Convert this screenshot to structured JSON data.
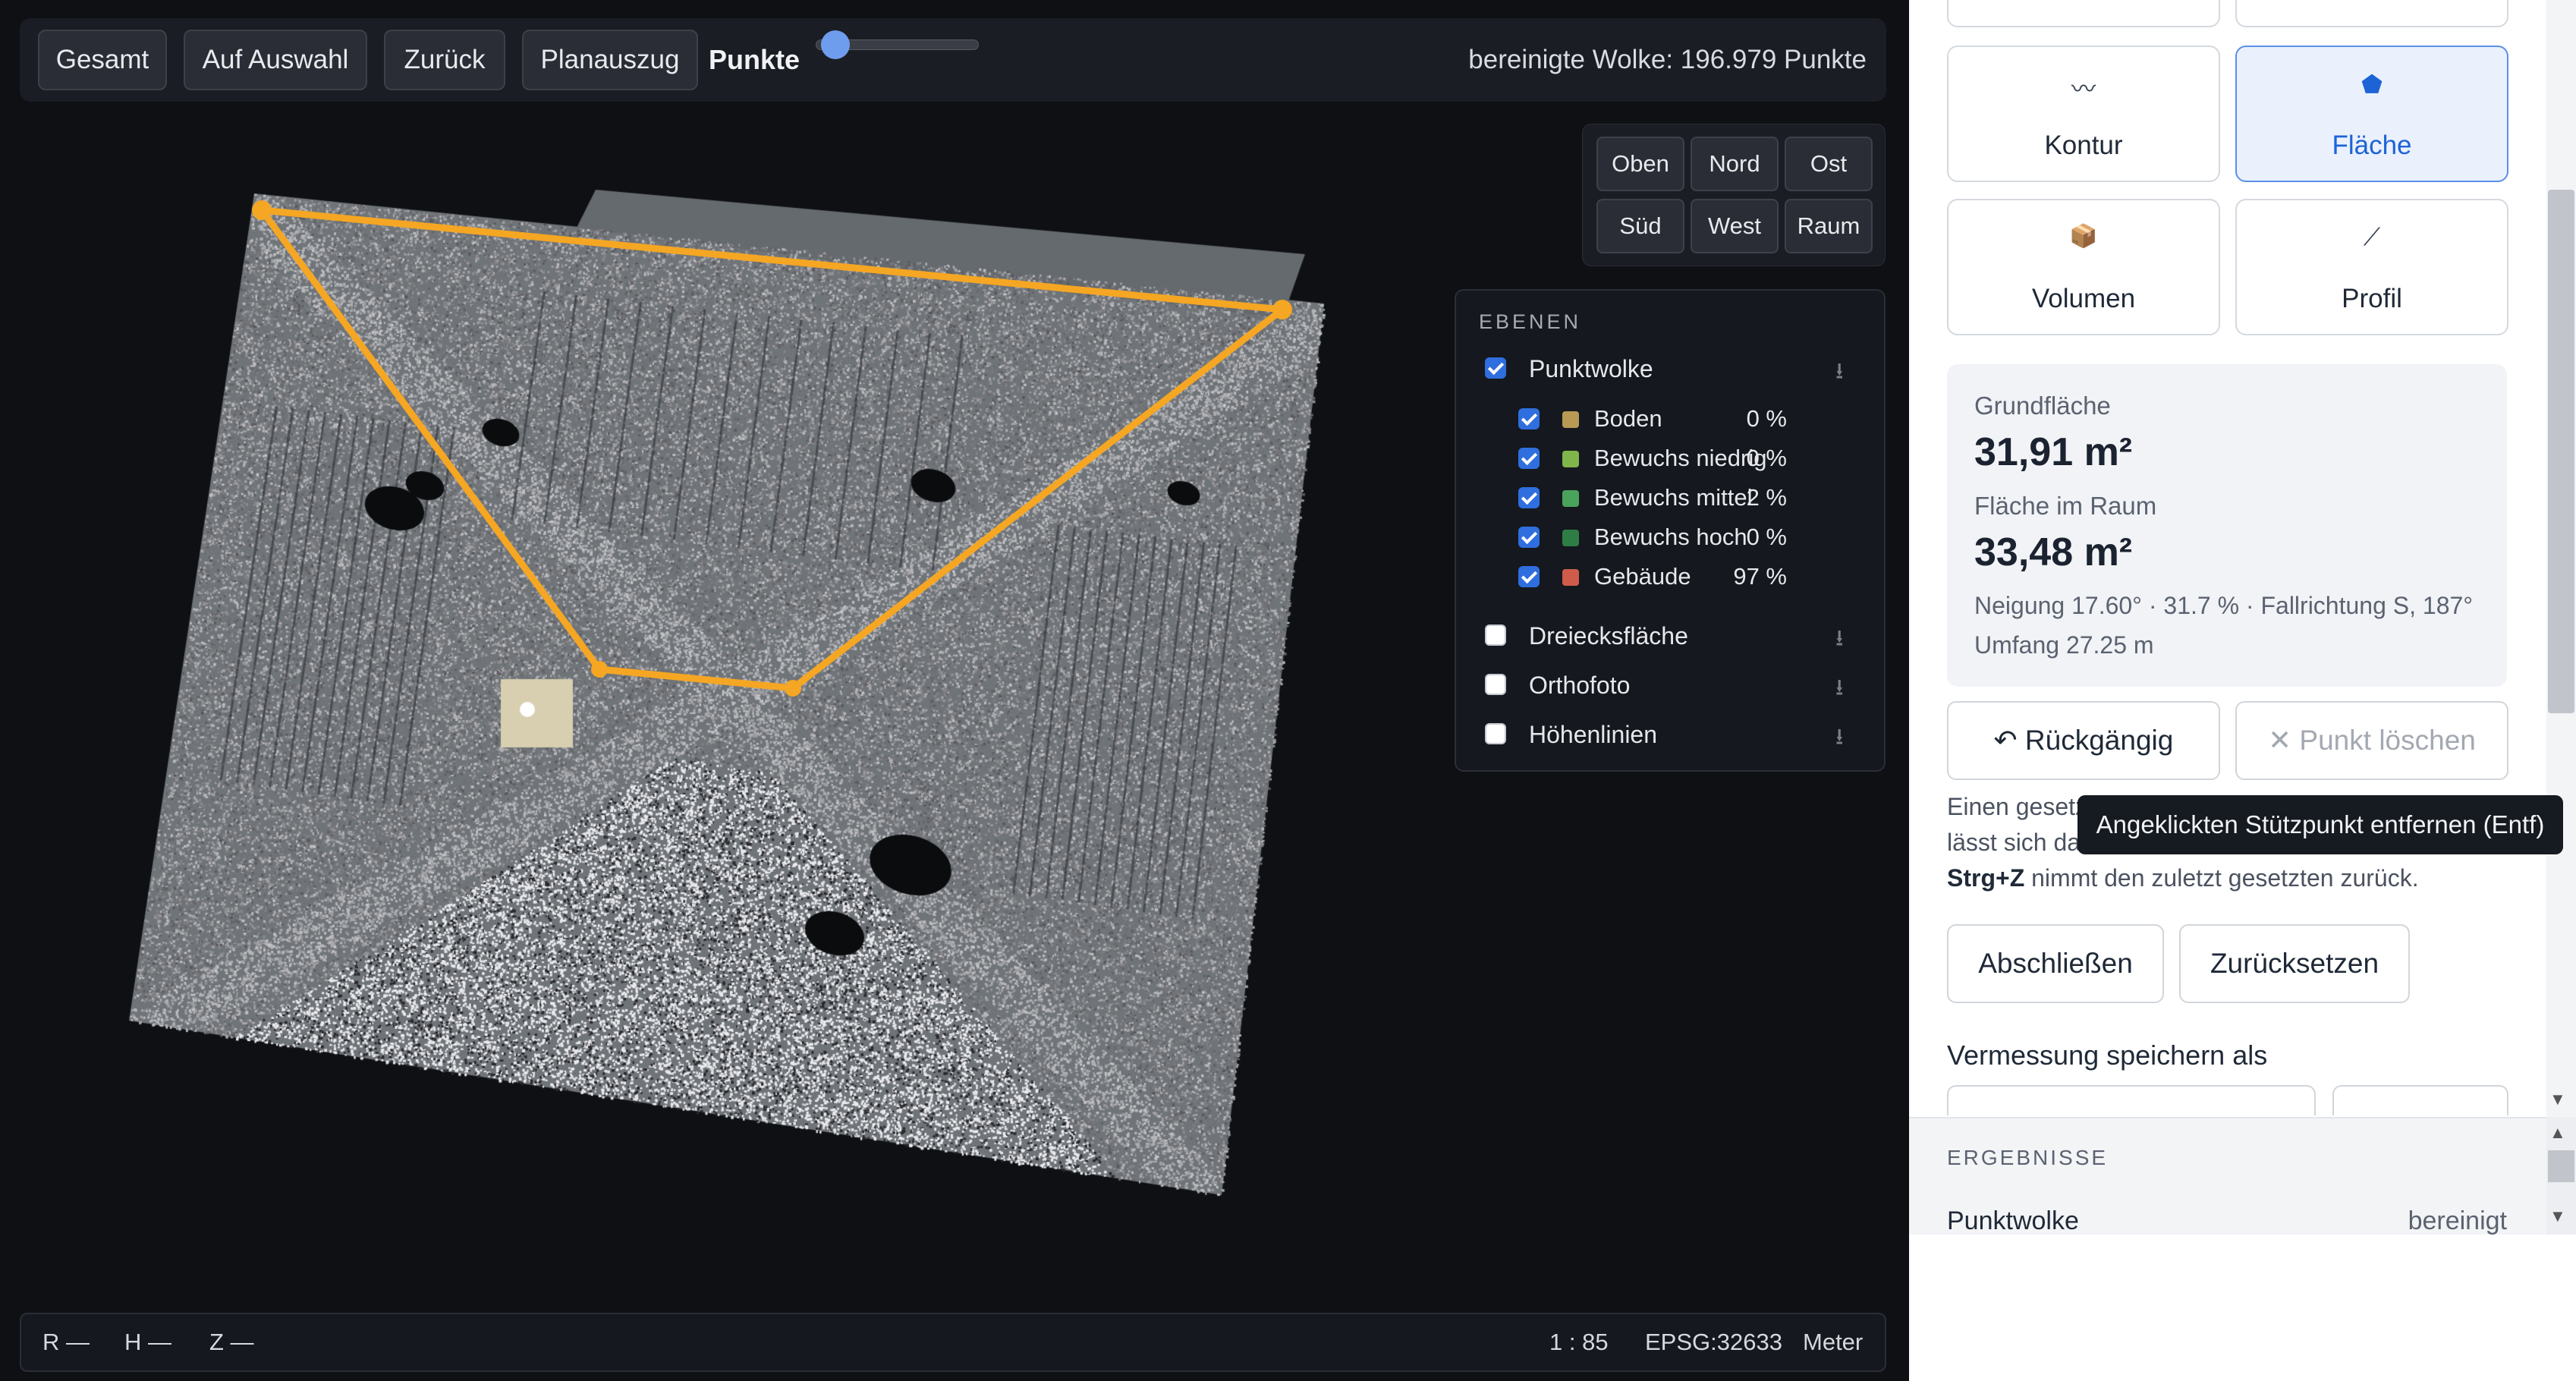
{
  "toolbar": {
    "buttons": [
      "Gesamt",
      "Auf Auswahl",
      "Zurück",
      "Planauszug"
    ],
    "points_label": "Punkte",
    "points_slider_value": 0.1,
    "status": "bereinigte Wolke: 196.979 Punkte"
  },
  "views": [
    "Oben",
    "Nord",
    "Ost",
    "Süd",
    "West",
    "Raum"
  ],
  "layers": {
    "title": "EBENEN",
    "pointcloud": {
      "label": "Punktwolke",
      "checked": true
    },
    "classes": [
      {
        "label": "Boden",
        "pct": "0 %",
        "color": "#b89a55",
        "checked": true
      },
      {
        "label": "Bewuchs niedrig",
        "pct": "0 %",
        "color": "#7fb54a",
        "checked": true
      },
      {
        "label": "Bewuchs mittel",
        "pct": "2 %",
        "color": "#4aa35a",
        "checked": true
      },
      {
        "label": "Bewuchs hoch",
        "pct": "0 %",
        "color": "#2e7d45",
        "checked": true
      },
      {
        "label": "Gebäude",
        "pct": "97 %",
        "color": "#cf5c4a",
        "checked": true
      }
    ],
    "extra": [
      {
        "label": "Dreiecksfläche",
        "checked": false
      },
      {
        "label": "Orthofoto",
        "checked": false
      },
      {
        "label": "Höhenlinien",
        "checked": false
      }
    ],
    "download_icon": "download-icon"
  },
  "statusbar": {
    "r": "R —",
    "h": "H —",
    "z": "Z —",
    "scale": "1 : 85",
    "epsg": "EPSG:32633",
    "unit": "Meter"
  },
  "tools": [
    {
      "label": "Kontur",
      "icon": "〰",
      "icon_name": "contour-icon",
      "active": false
    },
    {
      "label": "Fläche",
      "icon": "⬟",
      "icon_name": "area-icon",
      "active": true
    },
    {
      "label": "Volumen",
      "icon": "📦",
      "icon_name": "volume-icon",
      "active": false
    },
    {
      "label": "Profil",
      "icon": "⟋",
      "icon_name": "profile-icon",
      "active": false
    }
  ],
  "measurement": {
    "ground_label": "Grundfläche",
    "ground_value": "31,91 m²",
    "space_label": "Fläche im Raum",
    "space_value": "33,48 m²",
    "slope": "Neigung 17.60° · 31.7 % · Fallrichtung S, 187°",
    "perimeter": "Umfang 27.25 m"
  },
  "actions": {
    "undo": "↶ Rückgängig",
    "delete_point": "✕ Punkt löschen",
    "finish": "Abschließen",
    "reset": "Zurücksetzen"
  },
  "help": {
    "line1": "Einen gesetzten",
    "line2": "lässt sich da",
    "shortcut": "Strg+Z",
    "line3": " nimmt den zuletzt gesetzten zurück."
  },
  "tooltip": "Angeklickten Stützpunkt entfernen (Entf)",
  "save_section": "Vermessung speichern als",
  "results": {
    "title": "ERGEBNISSE",
    "row_label": "Punktwolke",
    "row_value": "bereinigt"
  },
  "colors": {
    "accent": "#2f6ede",
    "polygon": "#f5a623",
    "active_tool": "#1e63d6"
  }
}
